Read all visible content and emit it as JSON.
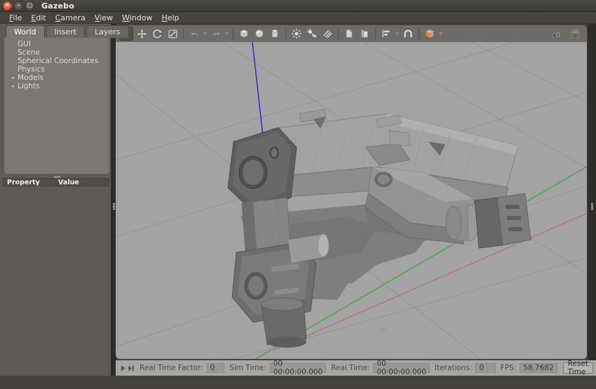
{
  "window": {
    "title": "Gazebo",
    "controls": [
      {
        "name": "close",
        "glyph": "×"
      },
      {
        "name": "minimize",
        "glyph": "–"
      },
      {
        "name": "maximize",
        "glyph": "□"
      }
    ]
  },
  "menubar": {
    "items": [
      {
        "label": "File",
        "mnemonic": "F"
      },
      {
        "label": "Edit",
        "mnemonic": "E"
      },
      {
        "label": "Camera",
        "mnemonic": "C"
      },
      {
        "label": "View",
        "mnemonic": "V"
      },
      {
        "label": "Window",
        "mnemonic": "W"
      },
      {
        "label": "Help",
        "mnemonic": "H"
      }
    ]
  },
  "left_panel": {
    "tabs": [
      {
        "label": "World",
        "active": true
      },
      {
        "label": "Insert",
        "active": false
      },
      {
        "label": "Layers",
        "active": false
      }
    ],
    "tree": [
      {
        "label": "GUI",
        "expandable": false
      },
      {
        "label": "Scene",
        "expandable": false
      },
      {
        "label": "Spherical Coordinates",
        "expandable": false
      },
      {
        "label": "Physics",
        "expandable": false
      },
      {
        "label": "Models",
        "expandable": true
      },
      {
        "label": "Lights",
        "expandable": true
      }
    ],
    "property_table": {
      "columns": [
        "Property",
        "Value"
      ],
      "rows": []
    }
  },
  "toolbar": {
    "tools": [
      {
        "name": "select-mode",
        "label": "Selection Mode",
        "active": true
      },
      {
        "name": "translate-mode",
        "label": "Translation Mode",
        "active": false
      },
      {
        "name": "rotate-mode",
        "label": "Rotation Mode",
        "active": false
      },
      {
        "name": "scale-mode",
        "label": "Scale Mode",
        "active": false
      }
    ],
    "history": [
      {
        "name": "undo",
        "label": "Undo",
        "enabled": false,
        "has_menu": true
      },
      {
        "name": "redo",
        "label": "Redo",
        "enabled": false,
        "has_menu": true
      }
    ],
    "shapes": [
      {
        "name": "box",
        "label": "Box"
      },
      {
        "name": "sphere",
        "label": "Sphere"
      },
      {
        "name": "cylinder",
        "label": "Cylinder"
      }
    ],
    "lights": [
      {
        "name": "point-light",
        "label": "Point Light"
      },
      {
        "name": "spot-light",
        "label": "Spot Light"
      },
      {
        "name": "directional-light",
        "label": "Directional Light"
      }
    ],
    "clipboard": [
      {
        "name": "copy",
        "label": "Copy"
      },
      {
        "name": "paste",
        "label": "Paste"
      }
    ],
    "align_snap": [
      {
        "name": "align",
        "label": "Align",
        "has_menu": true
      },
      {
        "name": "snap",
        "label": "Snap"
      }
    ],
    "view_mode": {
      "name": "view-angle",
      "label": "Change the view angle",
      "color": "#ee7f20",
      "has_menu": true
    },
    "right_tools": [
      {
        "name": "screenshot",
        "label": "Take a screenshot"
      },
      {
        "name": "log-record",
        "label": "Record a log file"
      }
    ]
  },
  "viewport": {
    "background_color": "#a3a3a3",
    "ground_color": "#9e9e9e",
    "grid_color": "#8a8a8a",
    "axes": [
      {
        "name": "x-axis",
        "color": "#cc2222"
      },
      {
        "name": "y-axis",
        "color": "#22bb22"
      },
      {
        "name": "z-axis",
        "color": "#2222dd"
      }
    ],
    "model": {
      "name": "robot-arm",
      "body_color": "#8e8e8e",
      "shade_color": "#6f6f6f",
      "dark_color": "#585858",
      "shadow_color": "#777777"
    }
  },
  "statusbar": {
    "play_button": {
      "name": "play",
      "label": "Play"
    },
    "step_button": {
      "name": "step",
      "label": "Step"
    },
    "real_time_factor_label": "Real Time Factor:",
    "real_time_factor_value": "0",
    "sim_time_label": "Sim Time:",
    "sim_time_value": "00 00:00:00.000",
    "real_time_label": "Real Time:",
    "real_time_value": "00 00:00:00.000",
    "iterations_label": "Iterations:",
    "iterations_value": "0",
    "fps_label": "FPS:",
    "fps_value": "58.7682",
    "reset_time_label": "Reset Time"
  }
}
